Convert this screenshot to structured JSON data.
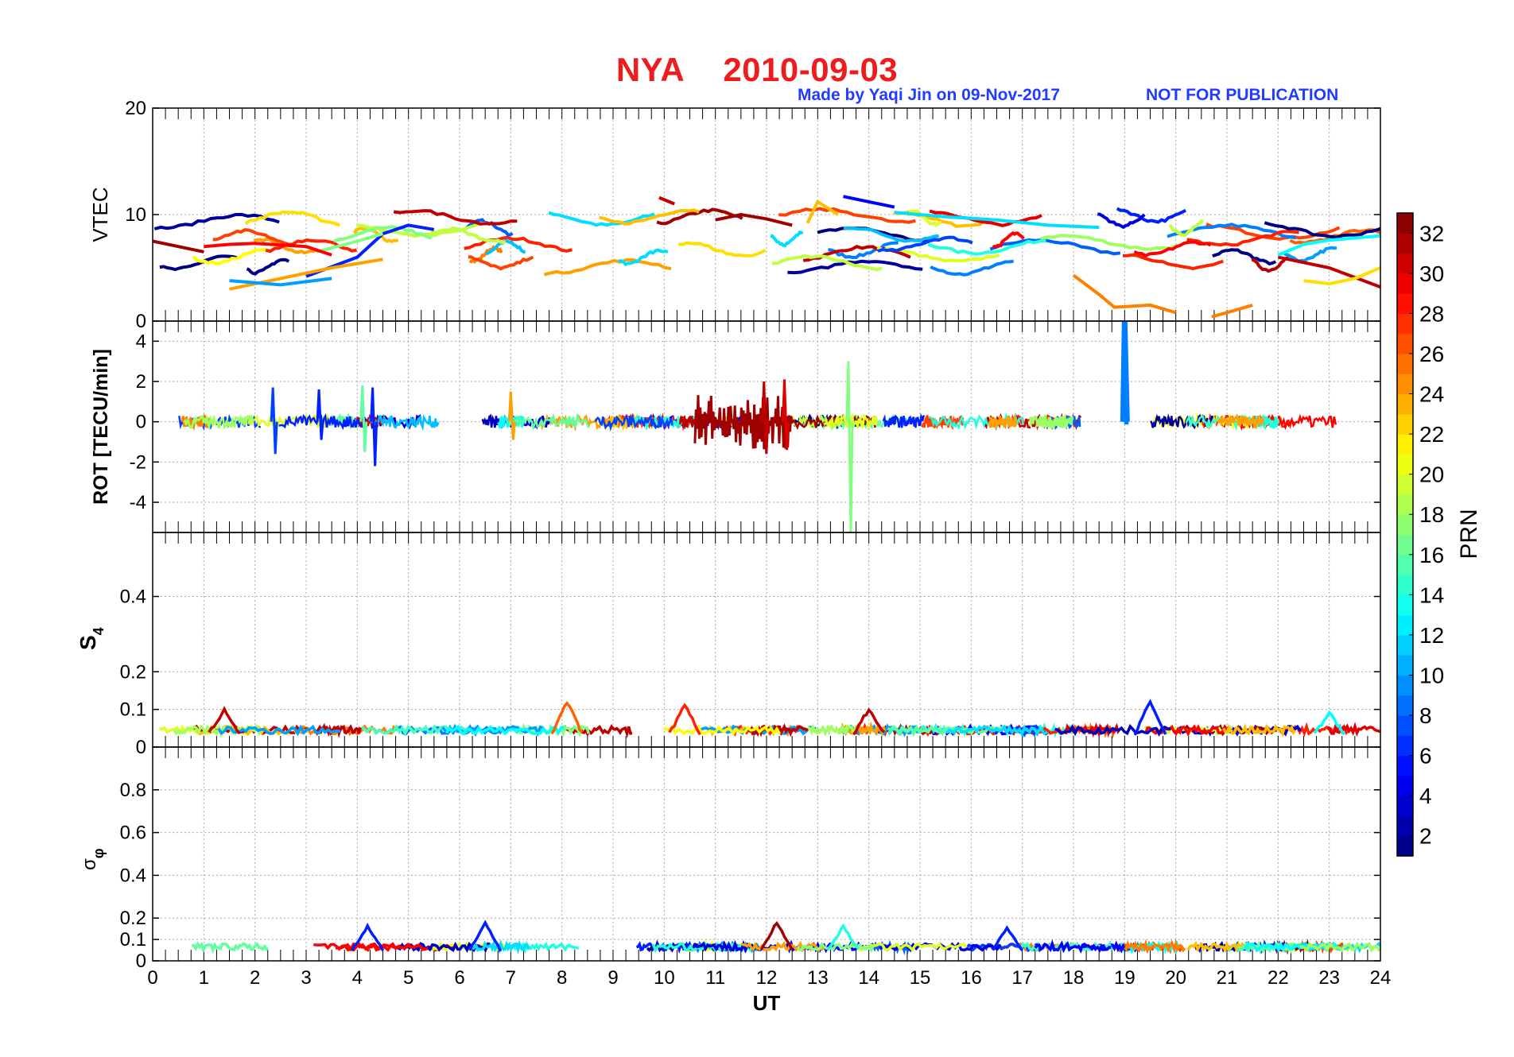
{
  "header": {
    "station": "NYA",
    "date": "2010-09-03",
    "credit": "Made by Yaqi Jin on 09-Nov-2017",
    "notice": "NOT FOR PUBLICATION"
  },
  "colors": {
    "title": "#ee1c1c",
    "credit": "#1f3cff",
    "colormap": "jet",
    "grid": "#9a9a9a"
  },
  "chart_data": [
    {
      "type": "line",
      "panel": "vtec",
      "ylabel": "VTEC",
      "ylim": [
        0,
        20
      ],
      "yticks": [
        0,
        10,
        20
      ],
      "xlim": [
        0,
        24
      ],
      "grid": true,
      "color_by": "PRN",
      "series": [
        {
          "prn": 6,
          "x": [
            3.0,
            4.0,
            4.5,
            5.0,
            5.5
          ],
          "values": [
            4.2,
            6.0,
            8.2,
            9.0,
            8.6
          ]
        },
        {
          "prn": 17,
          "x": [
            3.2,
            4.0,
            4.5
          ],
          "values": [
            6.5,
            7.5,
            8.2
          ]
        },
        {
          "prn": 29,
          "x": [
            1.0,
            1.5,
            2.0,
            3.0,
            3.5
          ],
          "values": [
            7.0,
            7.2,
            7.3,
            7.0,
            6.2
          ]
        },
        {
          "prn": 32,
          "x": [
            0.0,
            0.5,
            1.0
          ],
          "values": [
            7.5,
            7.0,
            6.5
          ]
        },
        {
          "prn": 24,
          "x": [
            1.5,
            2.5,
            3.5,
            4.5
          ],
          "values": [
            3.0,
            4.0,
            5.0,
            5.8
          ]
        },
        {
          "prn": 10,
          "x": [
            1.5,
            2.5,
            3.5
          ],
          "values": [
            3.8,
            3.4,
            4.0
          ]
        },
        {
          "prn": 31,
          "x": [
            9.9,
            10.2
          ],
          "values": [
            11.6,
            11.0
          ]
        },
        {
          "prn": 32,
          "x": [
            11.0,
            11.5,
            12.0,
            12.5
          ],
          "values": [
            9.5,
            10.0,
            9.6,
            9.0
          ]
        },
        {
          "prn": 23,
          "x": [
            12.8,
            13.0,
            13.4
          ],
          "values": [
            9.2,
            11.2,
            10.0
          ]
        },
        {
          "prn": 5,
          "x": [
            13.5,
            14.0,
            14.5
          ],
          "values": [
            11.7,
            11.2,
            10.7
          ]
        },
        {
          "prn": 12,
          "x": [
            14.5,
            15.5,
            16.5,
            17.5,
            18.5
          ],
          "values": [
            10.2,
            9.8,
            9.5,
            9.0,
            8.8
          ]
        },
        {
          "prn": 25,
          "x": [
            18.0,
            18.5,
            18.8,
            19.5,
            20.0
          ],
          "values": [
            4.3,
            2.5,
            1.3,
            1.5,
            0.8
          ]
        },
        {
          "prn": 25,
          "x": [
            20.7,
            21.0,
            21.5
          ],
          "values": [
            0.4,
            0.8,
            1.5
          ]
        },
        {
          "prn": 31,
          "x": [
            22.0,
            23.0,
            24.0
          ],
          "values": [
            6.0,
            5.0,
            3.2
          ]
        },
        {
          "prn": 13,
          "x": [
            22.0,
            22.5,
            23.0,
            23.5,
            24.0
          ],
          "values": [
            6.2,
            7.2,
            7.6,
            7.8,
            8.0
          ]
        },
        {
          "prn": 22,
          "x": [
            22.5,
            23.0,
            23.5,
            24.0
          ],
          "values": [
            3.8,
            3.5,
            4.0,
            5.0
          ]
        }
      ]
    },
    {
      "type": "line",
      "panel": "rot",
      "ylabel": "ROT [TECU/min]",
      "ylim": [
        -5.5,
        5
      ],
      "yticks": [
        -4,
        -2,
        0,
        2,
        4
      ],
      "xlim": [
        0,
        24
      ],
      "grid": true,
      "color_by": "PRN",
      "spikes": [
        {
          "prn": 7,
          "x": 2.35,
          "values": [
            1.7,
            -1.6
          ]
        },
        {
          "prn": 6,
          "x": 3.25,
          "values": [
            1.6,
            -0.9
          ]
        },
        {
          "prn": 6,
          "x": 4.3,
          "values": [
            1.7,
            -2.2
          ]
        },
        {
          "prn": 16,
          "x": 4.1,
          "values": [
            1.8,
            -1.5
          ]
        },
        {
          "prn": 17,
          "x": 13.6,
          "values": [
            3.0,
            -5.5
          ]
        },
        {
          "prn": 31,
          "x": 11.95,
          "values": [
            2.0,
            -1.6
          ]
        },
        {
          "prn": 30,
          "x": 12.35,
          "values": [
            2.1,
            -1.4
          ]
        },
        {
          "prn": 9,
          "x": 19.0,
          "values": [
            5.0,
            0.0
          ]
        },
        {
          "prn": 24,
          "x": 7.0,
          "values": [
            1.5,
            -0.9
          ]
        }
      ]
    },
    {
      "type": "line",
      "panel": "s4",
      "ylabel": "S4",
      "ylim": [
        0,
        0.57
      ],
      "yticks": [
        0,
        0.1,
        0.2,
        0.4
      ],
      "xlim": [
        0,
        24
      ],
      "grid": true,
      "color_by": "PRN",
      "peaks": [
        {
          "prn": 31,
          "x": 1.4,
          "value": 0.1
        },
        {
          "prn": 26,
          "x": 8.1,
          "value": 0.12
        },
        {
          "prn": 28,
          "x": 10.4,
          "value": 0.11
        },
        {
          "prn": 31,
          "x": 14.0,
          "value": 0.1
        },
        {
          "prn": 6,
          "x": 19.5,
          "value": 0.12
        },
        {
          "prn": 13,
          "x": 23.0,
          "value": 0.09
        }
      ]
    },
    {
      "type": "line",
      "panel": "sigma_phi",
      "ylabel": "σφ",
      "ylim": [
        0,
        1
      ],
      "yticks": [
        0,
        0.1,
        0.2,
        0.4,
        0.6,
        0.8
      ],
      "xlim": [
        0,
        24
      ],
      "xlabel": "UT",
      "xticks": [
        0,
        1,
        2,
        3,
        4,
        5,
        6,
        7,
        8,
        9,
        10,
        11,
        12,
        13,
        14,
        15,
        16,
        17,
        18,
        19,
        20,
        21,
        22,
        23,
        24
      ],
      "grid": true,
      "color_by": "PRN",
      "peaks": [
        {
          "prn": 6,
          "x": 4.2,
          "value": 0.16
        },
        {
          "prn": 6,
          "x": 6.5,
          "value": 0.18
        },
        {
          "prn": 32,
          "x": 12.2,
          "value": 0.18
        },
        {
          "prn": 14,
          "x": 13.5,
          "value": 0.16
        },
        {
          "prn": 6,
          "x": 16.7,
          "value": 0.15
        }
      ]
    }
  ],
  "colorbar": {
    "label": "PRN",
    "min": 1,
    "max": 33,
    "ticks": [
      2,
      4,
      6,
      8,
      10,
      12,
      14,
      16,
      18,
      20,
      22,
      24,
      26,
      28,
      30,
      32
    ]
  }
}
